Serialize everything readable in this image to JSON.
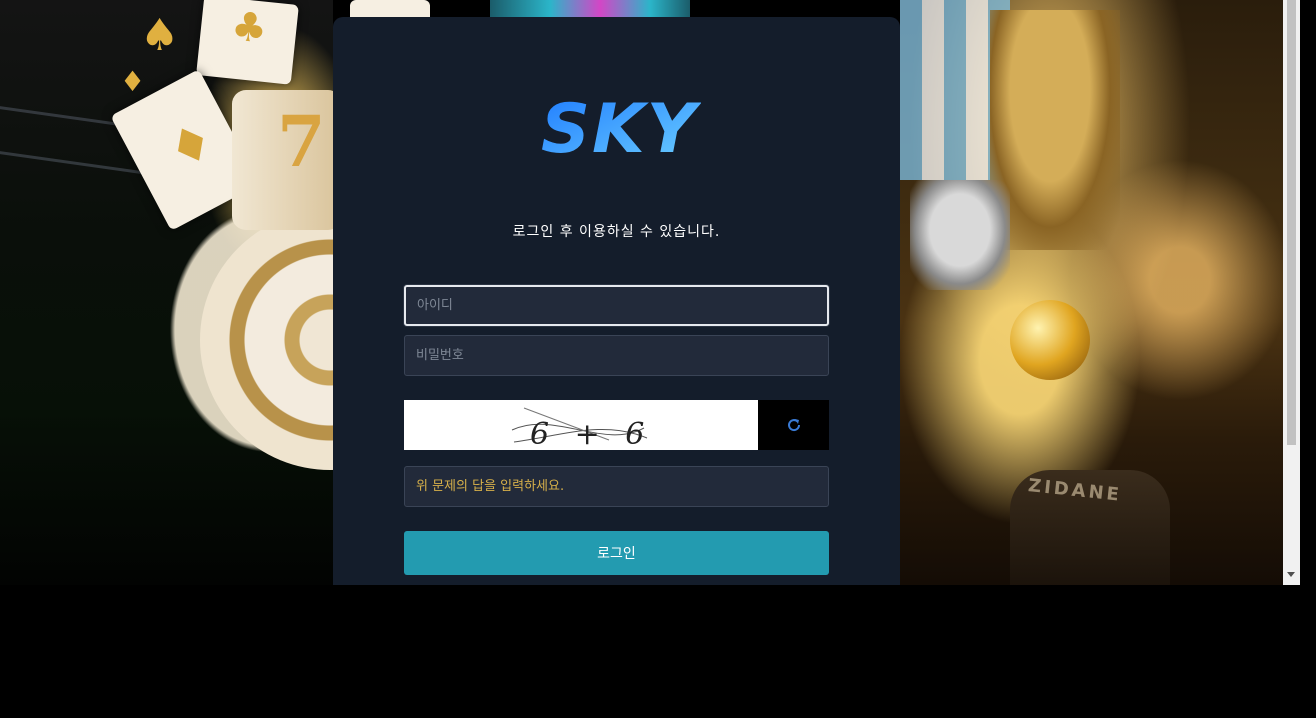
{
  "brand": {
    "logo_text": "SKY",
    "logo_colors": [
      "#1e7bff",
      "#6fd2ff"
    ]
  },
  "login": {
    "subtitle": "로그인 후 이용하실 수 있습니다.",
    "username_placeholder": "아이디",
    "password_placeholder": "비밀번호",
    "captcha_answer_placeholder": "위 문제의 답을 입력하세요.",
    "captcha_text": "6 + 6",
    "refresh_icon": "refresh-icon",
    "submit_label": "로그인"
  },
  "background": {
    "right_jersey_text": "ZIDANE"
  },
  "colors": {
    "panel": "#141d2b",
    "input_bg": "#222a3a",
    "button": "#239bb0",
    "answer_placeholder": "#d6b04a",
    "refresh_icon": "#3a7bd5"
  }
}
